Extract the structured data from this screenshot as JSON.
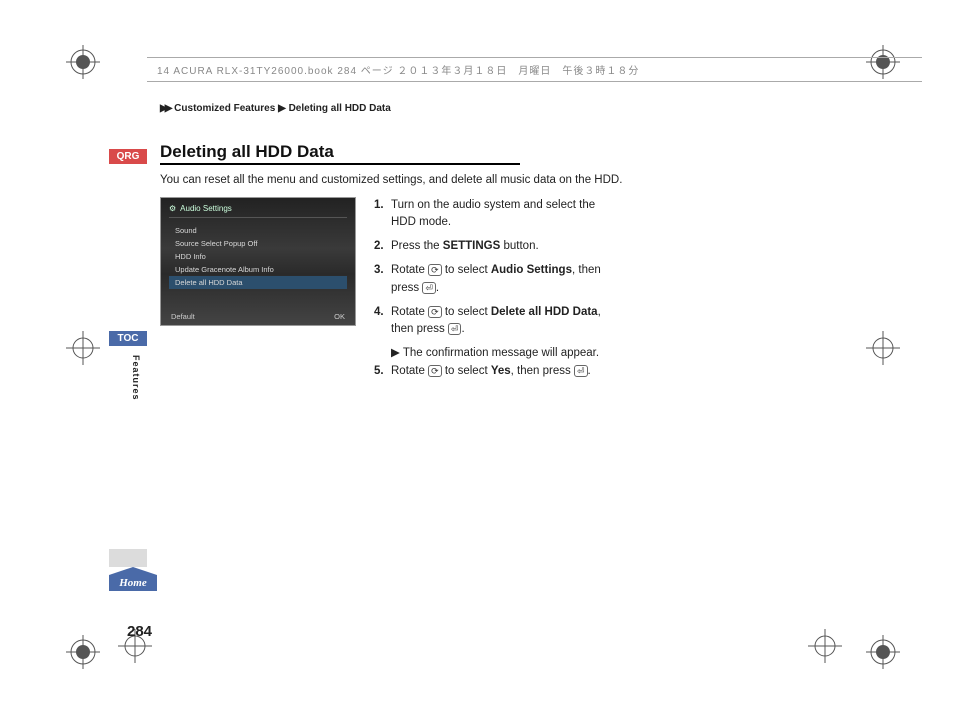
{
  "header_line": "14 ACURA RLX-31TY26000.book  284 ページ  ２０１３年３月１８日　月曜日　午後３時１８分",
  "breadcrumb": {
    "arrows": "▶▶",
    "level1": "Customized Features",
    "arrow2": "▶",
    "level2": "Deleting all HDD Data"
  },
  "tabs": {
    "qrg": "QRG",
    "toc": "TOC",
    "home": "Home",
    "side_label": "Features"
  },
  "title": "Deleting all HDD Data",
  "intro": "You can reset all the menu and customized settings, and delete all music data on the HDD.",
  "screenshot": {
    "title_icon": "⚙",
    "title": "Audio Settings",
    "rows": [
      {
        "label": "Sound",
        "value": ""
      },
      {
        "label": "Source Select Popup",
        "value": "Off"
      },
      {
        "label": "HDD Info",
        "value": ""
      },
      {
        "label": "Update Gracenote Album Info",
        "value": ""
      },
      {
        "label": "Delete all HDD Data",
        "value": "",
        "selected": true
      }
    ],
    "foot_left": "Default",
    "foot_right": "OK"
  },
  "icons": {
    "rotate": "⟳",
    "press": "⏎"
  },
  "steps": [
    {
      "n": "1.",
      "pre": "Turn on the audio system and select the HDD mode."
    },
    {
      "n": "2.",
      "pre": "Press the ",
      "b1": "SETTINGS",
      "post1": " button."
    },
    {
      "n": "3.",
      "pre": "Rotate ",
      "icon1": "rotate",
      "mid1": " to select ",
      "b1": "Audio Settings",
      "post1": ", then press ",
      "icon2": "press",
      "post2": "."
    },
    {
      "n": "4.",
      "pre": "Rotate ",
      "icon1": "rotate",
      "mid1": " to select ",
      "b1": "Delete all HDD Data",
      "post1": ", then press ",
      "icon2": "press",
      "post2": ".",
      "sub": "▶ The confirmation message will appear."
    },
    {
      "n": "5.",
      "pre": "Rotate ",
      "icon1": "rotate",
      "mid1": " to select ",
      "b1": "Yes",
      "post1": ", then press ",
      "icon2": "press",
      "post2": "."
    }
  ],
  "page_number": "284"
}
